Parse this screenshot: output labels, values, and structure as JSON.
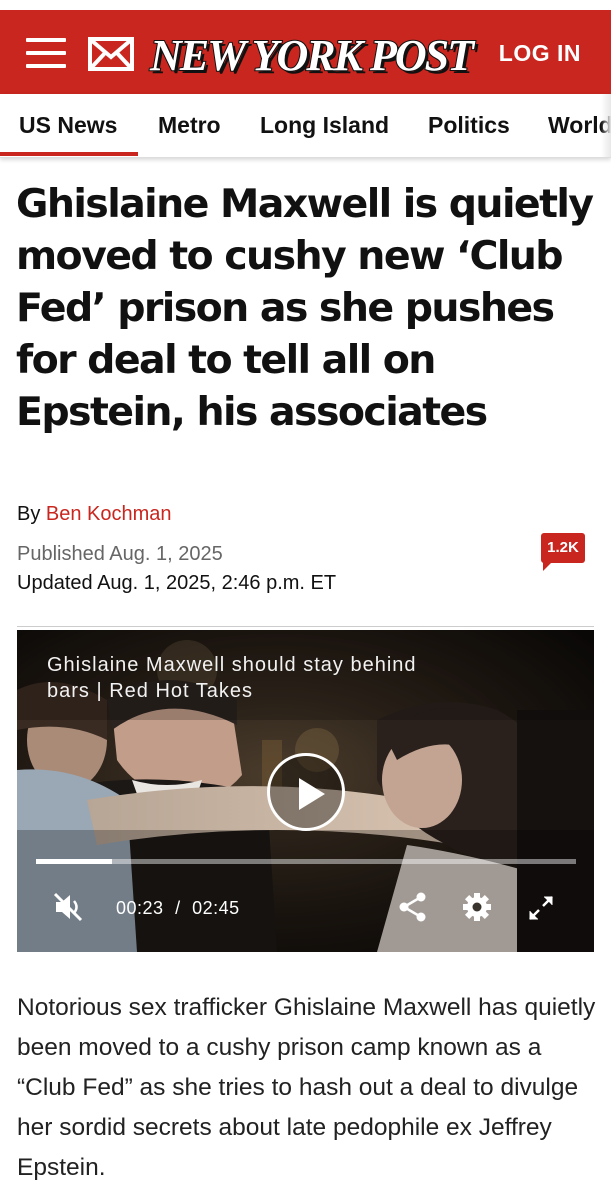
{
  "header": {
    "logo_text": "NEW YORK POST",
    "login_label": "LOG IN",
    "brand_color": "#c8261e"
  },
  "nav": {
    "items": [
      {
        "label": "US News",
        "active": true
      },
      {
        "label": "Metro"
      },
      {
        "label": "Long Island"
      },
      {
        "label": "Politics"
      },
      {
        "label": "World"
      }
    ]
  },
  "article": {
    "headline": "Ghislaine Maxwell is quietly moved to cushy new ‘Club Fed’ prison as she pushes for deal to tell all on Epstein, his associates",
    "byline_prefix": "By",
    "author": "Ben Kochman",
    "published": "Published Aug. 1, 2025",
    "updated": "Updated Aug. 1, 2025, 2:46 p.m. ET",
    "comment_count": "1.2K",
    "body_first_paragraph": "Notorious sex trafficker Ghislaine Maxwell has quietly been moved to a cushy prison camp known as a “Club Fed” as she tries to hash out a deal to divulge her sordid secrets about late pedophile ex Jeffrey Epstein."
  },
  "video": {
    "title": "Ghislaine Maxwell should stay behind bars | Red Hot Takes",
    "current_time": "00:23",
    "separator": "/",
    "duration": "02:45",
    "progress_fraction": 0.14,
    "icons": [
      "play-icon",
      "mute-icon",
      "share-icon",
      "settings-gear-icon",
      "fullscreen-icon"
    ]
  }
}
